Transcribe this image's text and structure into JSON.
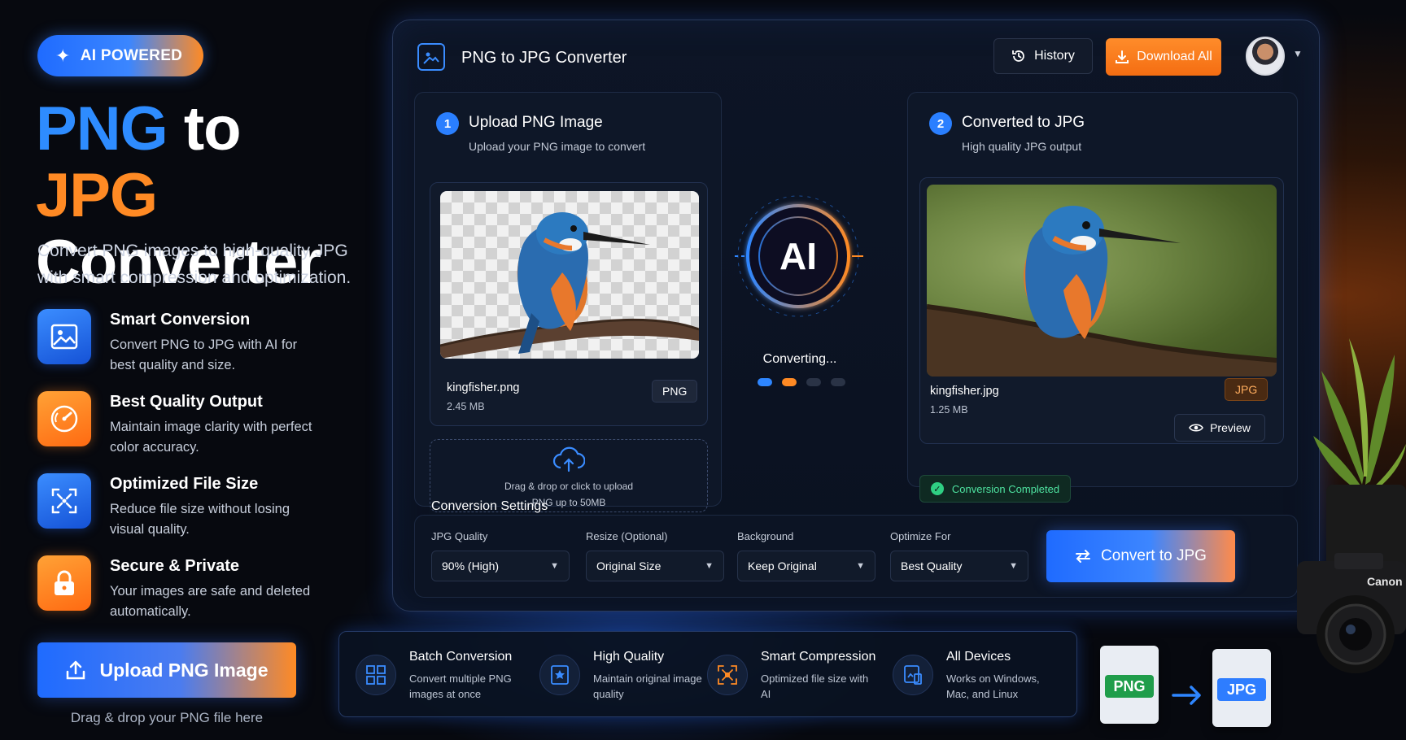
{
  "hero": {
    "badge": "AI POWERED",
    "title_png": "PNG",
    "title_to": "to",
    "title_jpg": "JPG",
    "title_line2": "Converter",
    "subtitle": "Convert PNG images to high-quality JPG with smart compression and optimization.",
    "features": [
      {
        "icon": "image-icon",
        "title": "Smart Conversion",
        "desc": "Convert PNG to JPG with AI for best quality and size.",
        "color": "blue"
      },
      {
        "icon": "gauge-icon",
        "title": "Best Quality Output",
        "desc": "Maintain image clarity with perfect color accuracy.",
        "color": "orange"
      },
      {
        "icon": "compress-icon",
        "title": "Optimized File Size",
        "desc": "Reduce file size without losing visual quality.",
        "color": "blue"
      },
      {
        "icon": "lock-icon",
        "title": "Secure & Private",
        "desc": "Your images are safe and deleted automatically.",
        "color": "orange"
      }
    ],
    "upload_button": "Upload PNG Image",
    "drag_hint": "Drag & drop your PNG file here"
  },
  "window": {
    "title": "PNG to JPG Converter",
    "history_button": "History",
    "download_button": "Download All"
  },
  "upload_panel": {
    "step": "1",
    "title": "Upload PNG Image",
    "subtitle": "Upload your PNG image to convert",
    "file_name": "kingfisher.png",
    "file_size": "2.45 MB",
    "format": "PNG",
    "dropzone_line1": "Drag & drop or click to upload",
    "dropzone_line2": "PNG up to 50MB"
  },
  "ai": {
    "label": "AI",
    "status": "Converting..."
  },
  "result_panel": {
    "step": "2",
    "title": "Converted to JPG",
    "subtitle": "High quality JPG output",
    "file_name": "kingfisher.jpg",
    "file_size": "1.25 MB",
    "format": "JPG",
    "preview_button": "Preview",
    "status": "Conversion Completed"
  },
  "settings": {
    "title": "Conversion Settings",
    "jpg_quality": {
      "label": "JPG Quality",
      "value": "90% (High)"
    },
    "resize": {
      "label": "Resize (Optional)",
      "value": "Original Size"
    },
    "background": {
      "label": "Background",
      "value": "Keep Original"
    },
    "optimize": {
      "label": "Optimize For",
      "value": "Best Quality"
    },
    "convert_button": "Convert to JPG"
  },
  "strip": [
    {
      "icon": "batch-icon",
      "title": "Batch Conversion",
      "desc": "Convert multiple PNG images at once"
    },
    {
      "icon": "quality-icon",
      "title": "High Quality",
      "desc": "Maintain original image quality"
    },
    {
      "icon": "compression-icon",
      "title": "Smart Compression",
      "desc": "Optimized file size with AI"
    },
    {
      "icon": "devices-icon",
      "title": "All Devices",
      "desc": "Works on Windows, Mac, and Linux"
    }
  ],
  "file_icons": {
    "png": "PNG",
    "jpg": "JPG"
  },
  "decor": {
    "camera_brand": "Canon"
  },
  "colors": {
    "accent_blue": "#2e8cff",
    "accent_orange": "#ff8a24",
    "success": "#4ee2a0"
  }
}
